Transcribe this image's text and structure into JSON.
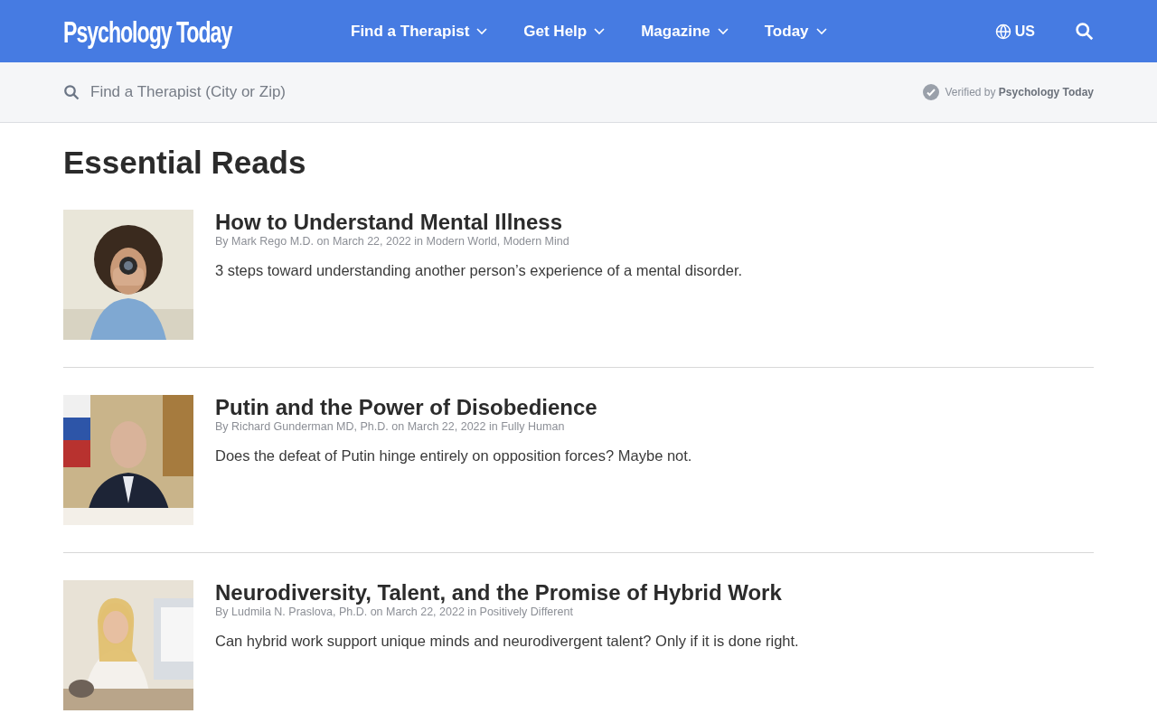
{
  "header": {
    "logo": "Psychology Today",
    "nav": [
      {
        "label": "Find a Therapist"
      },
      {
        "label": "Get Help"
      },
      {
        "label": "Magazine"
      },
      {
        "label": "Today"
      }
    ],
    "region": "US"
  },
  "search": {
    "placeholder": "Find a Therapist (City or Zip)",
    "verified_prefix": "Verified by",
    "verified_brand": "Psychology Today"
  },
  "section_title": "Essential Reads",
  "articles": [
    {
      "title": "How to Understand Mental Illness",
      "by": "By",
      "author": "Mark Rego M.D.",
      "on": "on",
      "date": "March 22, 2022",
      "in": "in",
      "category": "Modern World, Modern Mind",
      "teaser": "3 steps toward understanding another person’s experience of a mental disorder."
    },
    {
      "title": "Putin and the Power of Disobedience",
      "by": "By",
      "author": "Richard Gunderman MD, Ph.D.",
      "on": "on",
      "date": "March 22, 2022",
      "in": "in",
      "category": "Fully Human",
      "teaser": "Does the defeat of Putin hinge entirely on opposition forces? Maybe not."
    },
    {
      "title": "Neurodiversity, Talent, and the Promise of Hybrid Work",
      "by": "By",
      "author": "Ludmila N. Praslova, Ph.D.",
      "on": "on",
      "date": "March 22, 2022",
      "in": "in",
      "category": "Positively Different",
      "teaser": "Can hybrid work support unique minds and neurodivergent talent? Only if it is done right."
    }
  ]
}
